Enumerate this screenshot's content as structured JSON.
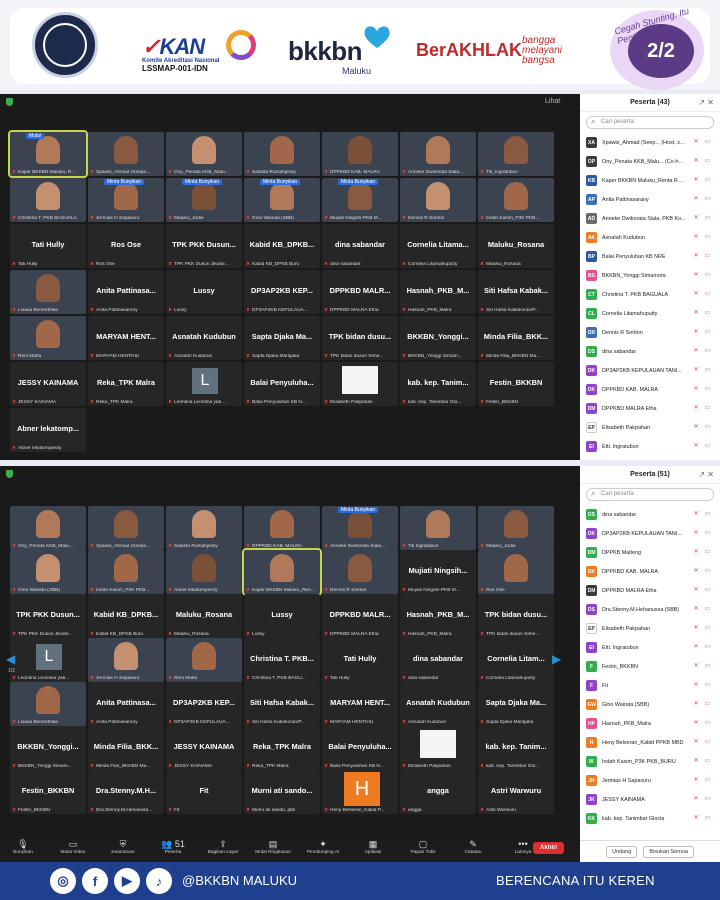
{
  "header": {
    "kan_logo": "KAN",
    "kan_subtitle": "Komite Akreditasi Nasional",
    "kan_code": "LSSMAP-001-IDN",
    "bkkbn_logo": "bkkbn",
    "bkkbn_region": "Maluku",
    "berakhlak": "BerAKHLAK",
    "berakhlak_tagline": "bangga melayani bangsa",
    "stunting_text": "Cegah Stunting, Itu Penting",
    "page_indicator": "2/2"
  },
  "panel_a": {
    "view_label": "Lihat",
    "tiles": [
      {
        "name": "",
        "caption": "Kaper BKKBN Maluku, R...",
        "video": true,
        "highlight": true,
        "tag": "Mulai"
      },
      {
        "name": "",
        "caption": "Xpawis_Ahmad (Seepo...",
        "video": true
      },
      {
        "name": "",
        "caption": "Ony_Penata KKB_Malu...",
        "video": true
      },
      {
        "name": "",
        "caption": "Salasta Rumahjessy",
        "video": true
      },
      {
        "name": "",
        "caption": "DPPKBD KAB. MALRA",
        "video": true
      },
      {
        "name": "",
        "caption": "Anneke Dwikorata Siala...",
        "video": true
      },
      {
        "name": "",
        "caption": "Titi_Ingratubun",
        "video": true
      },
      {
        "name": "",
        "caption": "Christina T. PKB BAGUALA",
        "video": true
      },
      {
        "name": "",
        "caption": "Jermias H Sapasuru",
        "video": true,
        "tag": "Minta Bunyikan"
      },
      {
        "name": "",
        "caption": "Maluku_Judie",
        "video": true,
        "tag": "Minta Bunyikan"
      },
      {
        "name": "",
        "caption": "Gino Wairata (SBB)",
        "video": true,
        "tag": "Minta Bunyikan"
      },
      {
        "name": "",
        "caption": "Mujiati Ningsih-PKB M...",
        "video": true,
        "tag": "Minta Bunyikan"
      },
      {
        "name": "",
        "caption": "Dennis R Soriton",
        "video": true
      },
      {
        "name": "",
        "caption": "Indah Kasim_P3K PKB...",
        "video": true
      },
      {
        "name": "Tati Hully",
        "caption": "Tati Hully"
      },
      {
        "name": "Ros Ose",
        "caption": "Ros Ose"
      },
      {
        "name": "TPK PKK Dusun...",
        "caption": "TPK PKK Dusun Jikube..."
      },
      {
        "name": "Kabid KB_DPKB...",
        "caption": "Kabid KB_DPKB Buru"
      },
      {
        "name": "dina sabandar",
        "caption": "dina sabandar"
      },
      {
        "name": "Cornelia Litama...",
        "caption": "Cornelia Litamahuputty"
      },
      {
        "name": "Maluku_Rosana",
        "caption": "Maluku_Rosana"
      },
      {
        "name": "",
        "caption": "Louisa Berendhika",
        "video": true
      },
      {
        "name": "Anita Pattinasa...",
        "caption": "Anita Pattinasarany"
      },
      {
        "name": "Lussy",
        "caption": "Lussy"
      },
      {
        "name": "DP3AP2KB KEP...",
        "caption": "DP3AP2KB KEPULAUA..."
      },
      {
        "name": "DPPKBD MALR...",
        "caption": "DPPKBD MALRA Etha"
      },
      {
        "name": "Hasnah_PKB_M...",
        "caption": "Hasnah_PKB_Malra"
      },
      {
        "name": "Siti Hafsa Kabak...",
        "caption": "Siti Hafsa Kabakoran/P..."
      },
      {
        "name": "",
        "caption": "Reni Malra",
        "video": true
      },
      {
        "name": "MARYAM HENT...",
        "caption": "MARYAM HENTIHU"
      },
      {
        "name": "Asnatah Kudubun",
        "caption": "Asnatah Kudubun"
      },
      {
        "name": "Sapta Djaka Ma...",
        "caption": "Sapta Djaka Mardjaka"
      },
      {
        "name": "TPK bidan dusu...",
        "caption": "TPK bidan dusun Sehe..."
      },
      {
        "name": "BKKBN_Yonggi...",
        "caption": "BKKBN_Yonggi Simam..."
      },
      {
        "name": "Minda Filia_BKK...",
        "caption": "Minda Filia_BKKBN Ma..."
      },
      {
        "name": "JESSY KAINAMA",
        "caption": "JESSY KAINAMA"
      },
      {
        "name": "Reka_TPK Malra",
        "caption": "Reka_TPK Malra"
      },
      {
        "name": "",
        "caption": "Leontina Leontina yab...",
        "avatar": "L"
      },
      {
        "name": "Balai Penyuluha...",
        "caption": "Balai Penyuluhan KB N..."
      },
      {
        "name": "",
        "caption": "Elisabeth Pakpahan",
        "white": true
      },
      {
        "name": "kab. kep. Tanim...",
        "caption": "kab. kep. Tanimbar Glo..."
      },
      {
        "name": "Festin_BKKBN",
        "caption": "Festin_BKKBN"
      },
      {
        "name": "Abner lekatomp...",
        "caption": "Abner lekatompessy"
      }
    ],
    "sidebar": {
      "title": "Peserta (43)",
      "search_placeholder": "Cari peserta",
      "participants": [
        {
          "initials": "XA",
          "name": "Xpawis_Ahmad (Seep... (Host, saya)",
          "color": "#3b3b3b"
        },
        {
          "initials": "OP",
          "name": "Ony_Penata KKB_Malu... (Co-host)",
          "color": "#3b3b3b"
        },
        {
          "initials": "KB",
          "name": "Kaper BKKBN Maluku_Renta Rego",
          "color": "#2a5aa6"
        },
        {
          "initials": "AP",
          "name": "Anita Pattinasarany",
          "color": "#3b6fb6"
        },
        {
          "initials": "AD",
          "name": "Anneke Dwikorata Siala. PKB Ko...",
          "color": "#6a6a6a"
        },
        {
          "initials": "AK",
          "name": "Asnatah Kudubun",
          "color": "#ef7b22"
        },
        {
          "initials": "BP",
          "name": "Balai Penyuluhan KB NRE",
          "color": "#2a5aa6"
        },
        {
          "initials": "BS",
          "name": "BKKBN_Yonggi Simamora",
          "color": "#e84f8c"
        },
        {
          "initials": "CT",
          "name": "Christina T. PKB BAGUALA",
          "color": "#2fae4e"
        },
        {
          "initials": "CL",
          "name": "Cornelia Litamahuputty",
          "color": "#2fae4e"
        },
        {
          "initials": "DR",
          "name": "Dennis R Soriton",
          "color": "#3b6fb6"
        },
        {
          "initials": "DS",
          "name": "dina sabandar",
          "color": "#2fae4e"
        },
        {
          "initials": "DK",
          "name": "DP3AP2KB KEPULAUAN TANIMB...",
          "color": "#8e44c9"
        },
        {
          "initials": "DK",
          "name": "DPPKBD KAB. MALRA",
          "color": "#8e44c9"
        },
        {
          "initials": "DM",
          "name": "DPPKBD MALRA Etha",
          "color": "#8e44c9"
        },
        {
          "initials": "EP",
          "name": "Elisabeth Pakpahan",
          "color": "#ffffff"
        },
        {
          "initials": "EI",
          "name": "Etti. Ingratubun",
          "color": "#8e44c9"
        }
      ]
    }
  },
  "panel_b": {
    "tiles": [
      {
        "name": "",
        "caption": "Ony_Penata KKB_Malu...",
        "video": true
      },
      {
        "name": "",
        "caption": "Xpawis_Ahmad (Seepo...",
        "video": true
      },
      {
        "name": "",
        "caption": "Salasta Rumahjessy",
        "video": true
      },
      {
        "name": "",
        "caption": "DPPKBD KAB. MALRA",
        "video": true
      },
      {
        "name": "",
        "caption": "Anneke Dwikorata Siala...",
        "video": true,
        "tag": "Minta Bunyikan"
      },
      {
        "name": "",
        "caption": "Titi Ingratubun",
        "video": true
      },
      {
        "name": "",
        "caption": "Maluku_Judie",
        "video": true
      },
      {
        "name": "",
        "caption": "Gino Wairata (SBB)",
        "video": true
      },
      {
        "name": "",
        "caption": "Indah Kasim_P3K PKB...",
        "video": true
      },
      {
        "name": "",
        "caption": "Abner lekatompessy",
        "video": true
      },
      {
        "name": "",
        "caption": "Kaper BKKBN Maluku_Ren...",
        "video": true,
        "highlight": true
      },
      {
        "name": "",
        "caption": "Dennis R Soriton",
        "video": true
      },
      {
        "name": "Mujiati Ningsih...",
        "caption": "Mujiati Ningsih-PKB M..."
      },
      {
        "name": "",
        "caption": "Ros Ose",
        "video": true
      },
      {
        "name": "TPK PKK Dusun...",
        "caption": "TPK PKK Dusun Jikube..."
      },
      {
        "name": "Kabid KB_DPKB...",
        "caption": "Kabid KB_DPKB Buru"
      },
      {
        "name": "Maluku_Rosana",
        "caption": "Maluku_Rosana"
      },
      {
        "name": "Lussy",
        "caption": "Lussy"
      },
      {
        "name": "DPPKBD MALR...",
        "caption": "DPPKBD MALRA Etha"
      },
      {
        "name": "Hasnah_PKB_M...",
        "caption": "Hasnah_PKB_Malra"
      },
      {
        "name": "TPK bidan dusu...",
        "caption": "TPK bidan dusun Sehe..."
      },
      {
        "name": "",
        "caption": "Leontina Leontina yab...",
        "avatar": "L"
      },
      {
        "name": "",
        "caption": "Jermias H Sapasuru",
        "video": true
      },
      {
        "name": "",
        "caption": "Reni Malra",
        "video": true
      },
      {
        "name": "Christina T. PKB...",
        "caption": "Christina T. PKB BAGU..."
      },
      {
        "name": "Tati Hully",
        "caption": "Tati Hully"
      },
      {
        "name": "dina sabandar",
        "caption": "dina sabandar"
      },
      {
        "name": "Cornelia Litam...",
        "caption": "Cornelia Litamahuputty"
      },
      {
        "name": "",
        "caption": "Louisa Berendhika",
        "video": true
      },
      {
        "name": "Anita Pattinasa...",
        "caption": "Anita Pattinasarany"
      },
      {
        "name": "DP3AP2KB KEP...",
        "caption": "DP3AP2KB KEPULAUA..."
      },
      {
        "name": "Siti Hafsa Kabak...",
        "caption": "Siti Hafsa Kabakoran/P..."
      },
      {
        "name": "MARYAM HENT...",
        "caption": "MARYAM HENTIHU"
      },
      {
        "name": "Asnatah Kudubun",
        "caption": "Asnatah Kudubun"
      },
      {
        "name": "Sapta Djaka Ma...",
        "caption": "Sapta Djaka Mardjaka"
      },
      {
        "name": "BKKBN_Yonggi...",
        "caption": "BKKBN_Yonggi Simam..."
      },
      {
        "name": "Minda Filia_BKK...",
        "caption": "Minda Filia_BKKBN Ma..."
      },
      {
        "name": "JESSY KAINAMA",
        "caption": "JESSY KAINAMA"
      },
      {
        "name": "Reka_TPK Malra",
        "caption": "Reka_TPK Malra"
      },
      {
        "name": "Balai Penyuluha...",
        "caption": "Balai Penyuluhan KB N..."
      },
      {
        "name": "",
        "caption": "Elisabeth Pakpahan",
        "white": true
      },
      {
        "name": "kab. kep. Tanim...",
        "caption": "kab. kep. Tanimbar Glo..."
      },
      {
        "name": "Festin_BKKBN",
        "caption": "Festin_BKKBN"
      },
      {
        "name": "Dra.Stenny.M.H...",
        "caption": "Dra.Stenny.M.Hehanusa..."
      },
      {
        "name": "Fit",
        "caption": "Fit"
      },
      {
        "name": "Murni ati sando...",
        "caption": "Murni ati sando, pkb"
      },
      {
        "name": "",
        "caption": "Heny Belseran_Kabid P...",
        "avatar": "H"
      },
      {
        "name": "angga",
        "caption": "angga"
      },
      {
        "name": "Astri Warwuru",
        "caption": "Astri Warwuru"
      }
    ],
    "sidebar": {
      "title": "Peserta (51)",
      "search_placeholder": "Cari peserta",
      "participants": [
        {
          "initials": "DS",
          "name": "dina sabandar",
          "color": "#2fae4e"
        },
        {
          "initials": "DK",
          "name": "DP3AP2KB KEPULAUAN TANIMB...",
          "color": "#8e44c9"
        },
        {
          "initials": "DM",
          "name": "DPPKB Malteng",
          "color": "#2fae4e"
        },
        {
          "initials": "DK",
          "name": "DPPKBD KAB. MALRA",
          "color": "#ef7b22"
        },
        {
          "initials": "DM",
          "name": "DPPKBD MALRA Etha",
          "color": "#3b3b3b"
        },
        {
          "initials": "DS",
          "name": "Dra.Stenny.M.Hehanussa (SBB)",
          "color": "#8e44c9"
        },
        {
          "initials": "EP",
          "name": "Elisabeth Pakpahan",
          "color": "#ffffff"
        },
        {
          "initials": "EI",
          "name": "Etti. Ingratubun",
          "color": "#8e44c9"
        },
        {
          "initials": "F",
          "name": "Festin_BKKBN",
          "color": "#2fae4e"
        },
        {
          "initials": "F",
          "name": "Fit",
          "color": "#8e44c9"
        },
        {
          "initials": "GW",
          "name": "Gino Wairata (SBB)",
          "color": "#ef7b22"
        },
        {
          "initials": "HP",
          "name": "Hasnah_PKB_Malra",
          "color": "#e84f8c"
        },
        {
          "initials": "H",
          "name": "Heny Belseran_Kabid PPKB MBD",
          "color": "#ef7b22"
        },
        {
          "initials": "IK",
          "name": "Indah Kasim_P3K PKB_BURU",
          "color": "#2fae4e"
        },
        {
          "initials": "JH",
          "name": "Jermias H Sapasuru",
          "color": "#ef7b22"
        },
        {
          "initials": "JK",
          "name": "JESSY KAINAMA",
          "color": "#8e44c9"
        },
        {
          "initials": "KK",
          "name": "kab. kep. Tanimbar Glocia",
          "color": "#2fae4e"
        }
      ],
      "btn_invite": "Undang",
      "btn_mute_all": "Bisukan Semua"
    },
    "page_label": "1/2",
    "toolbar": [
      {
        "icon": "mic-icon",
        "glyph": "🎙",
        "label": "Bunyikan"
      },
      {
        "icon": "video-icon",
        "glyph": "▭",
        "label": "Mulai Video"
      },
      {
        "icon": "shield-icon",
        "glyph": "⛨",
        "label": "Keamanan"
      },
      {
        "icon": "participants-icon",
        "glyph": "👥 51",
        "label": "Peserta"
      },
      {
        "icon": "share-icon",
        "glyph": "⇪",
        "label": "Bagikan Layar"
      },
      {
        "icon": "summary-icon",
        "glyph": "▤",
        "label": "Mulai Ringkasan"
      },
      {
        "icon": "assistant-icon",
        "glyph": "✦",
        "label": "Pendamping AI"
      },
      {
        "icon": "apps-icon",
        "glyph": "▦",
        "label": "Aplikasi"
      },
      {
        "icon": "whiteboard-icon",
        "glyph": "▢",
        "label": "Papan Tulis"
      },
      {
        "icon": "notes-icon",
        "glyph": "✎",
        "label": "Catatan"
      },
      {
        "icon": "more-icon",
        "glyph": "•••",
        "label": "Lainnya"
      }
    ],
    "end_label": "Akhiri"
  },
  "footer": {
    "handle": "@BKKBN MALUKU",
    "slogan": "BERENCANA ITU KEREN",
    "socials": [
      {
        "icon": "instagram-icon",
        "glyph": "◎"
      },
      {
        "icon": "facebook-icon",
        "glyph": "f"
      },
      {
        "icon": "youtube-icon",
        "glyph": "▶"
      },
      {
        "icon": "tiktok-icon",
        "glyph": "♪"
      }
    ]
  }
}
